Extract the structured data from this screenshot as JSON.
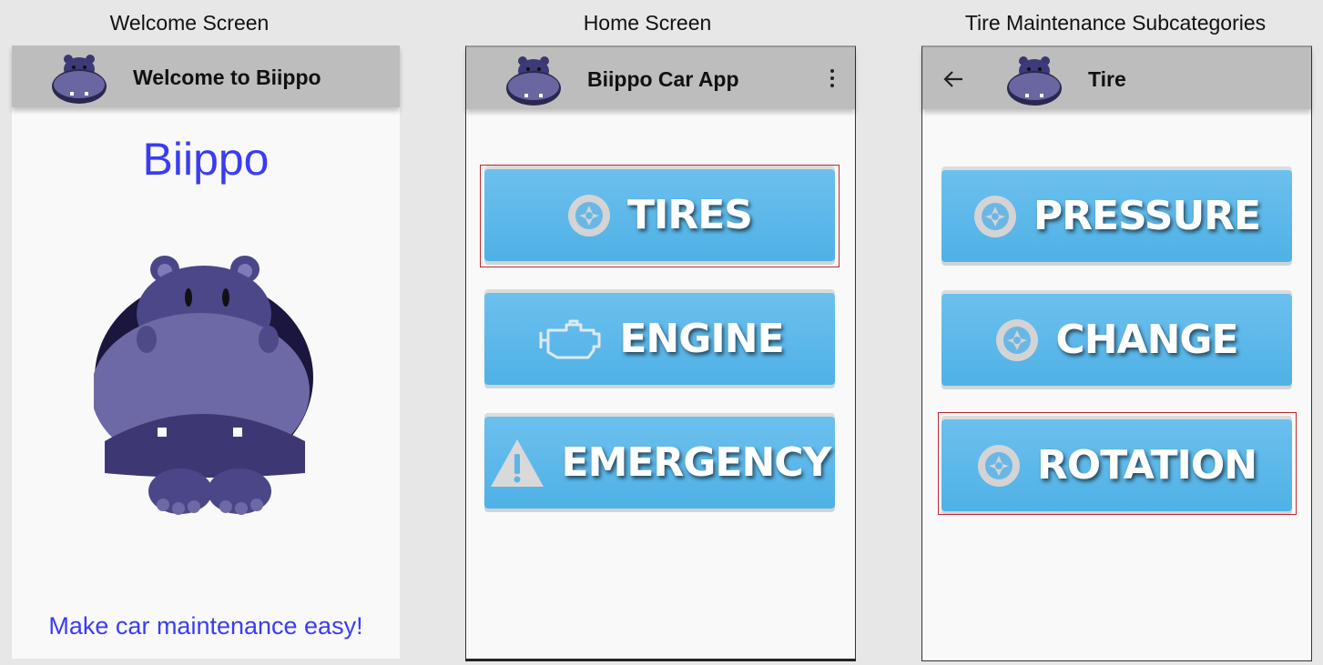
{
  "captions": {
    "welcome": "Welcome Screen",
    "home": "Home Screen",
    "tire": "Tire Maintenance Subcategories"
  },
  "welcome_screen": {
    "appbar_title": "Welcome to Biippo",
    "brand": "Biippo",
    "tagline": "Make car maintenance easy!"
  },
  "home_screen": {
    "appbar_title": "Biippo Car App",
    "buttons": [
      {
        "label": "TIRES",
        "icon": "tire-icon",
        "highlighted": true
      },
      {
        "label": "ENGINE",
        "icon": "engine-icon",
        "highlighted": false
      },
      {
        "label": "EMERGENCY",
        "icon": "warning-icon",
        "highlighted": false
      }
    ]
  },
  "tire_screen": {
    "appbar_title": "Tire",
    "buttons": [
      {
        "label": "PRESSURE",
        "icon": "tire-icon",
        "highlighted": false
      },
      {
        "label": "CHANGE",
        "icon": "tire-icon",
        "highlighted": false
      },
      {
        "label": "ROTATION",
        "icon": "tire-icon",
        "highlighted": true
      }
    ]
  },
  "colors": {
    "brand_text": "#3b3bf5",
    "appbar": "#bdbdbd",
    "tile": "#56b4e7",
    "highlight": "#c1272d",
    "hippo": "#5e5a94"
  }
}
